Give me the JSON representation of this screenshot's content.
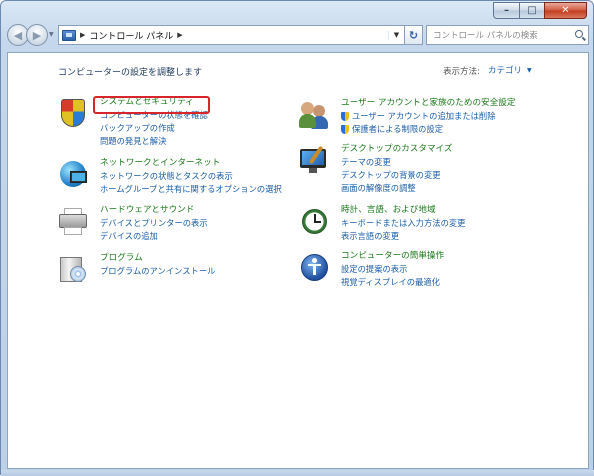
{
  "window": {
    "minimize_label": "–",
    "maximize_label": "□",
    "close_label": "✕"
  },
  "navbar": {
    "address": "コントロール パネル",
    "search_placeholder": "コントロール パネルの検索"
  },
  "main": {
    "title": "コンピューターの設定を調整します",
    "view_label": "表示方法:",
    "view_value": "カテゴリ"
  },
  "categories": {
    "security": {
      "title": "システムとセキュリティ",
      "links": [
        "コンピューターの状態を確認",
        "バックアップの作成",
        "問題の発見と解決"
      ]
    },
    "network": {
      "title": "ネットワークとインターネット",
      "links": [
        "ネットワークの状態とタスクの表示",
        "ホームグループと共有に関するオプションの選択"
      ]
    },
    "hardware": {
      "title": "ハードウェアとサウンド",
      "links": [
        "デバイスとプリンターの表示",
        "デバイスの追加"
      ]
    },
    "programs": {
      "title": "プログラム",
      "links": [
        "プログラムのアンインストール"
      ]
    },
    "user": {
      "title": "ユーザー アカウントと家族のための安全設定",
      "links": [
        "ユーザー アカウントの追加または削除",
        "保護者による制限の設定"
      ]
    },
    "appearance": {
      "title": "デスクトップのカスタマイズ",
      "links": [
        "テーマの変更",
        "デスクトップの背景の変更",
        "画面の解像度の調整"
      ]
    },
    "clock": {
      "title": "時計、言語、および地域",
      "links": [
        "キーボードまたは入力方法の変更",
        "表示言語の変更"
      ]
    },
    "access": {
      "title": "コンピューターの簡単操作",
      "links": [
        "設定の提案の表示",
        "視覚ディスプレイの最適化"
      ]
    }
  },
  "icons": {
    "security": "shield-icon",
    "user": "users-icon",
    "network": "globe-network-icon",
    "appearance": "monitor-paint-icon",
    "hardware": "printer-icon",
    "clock": "clock-globe-icon",
    "programs": "programs-box-icon",
    "access": "accessibility-icon"
  },
  "colors": {
    "category_title": "#1b7a1b",
    "link": "#1b5ea8",
    "highlight": "#d8252b"
  }
}
